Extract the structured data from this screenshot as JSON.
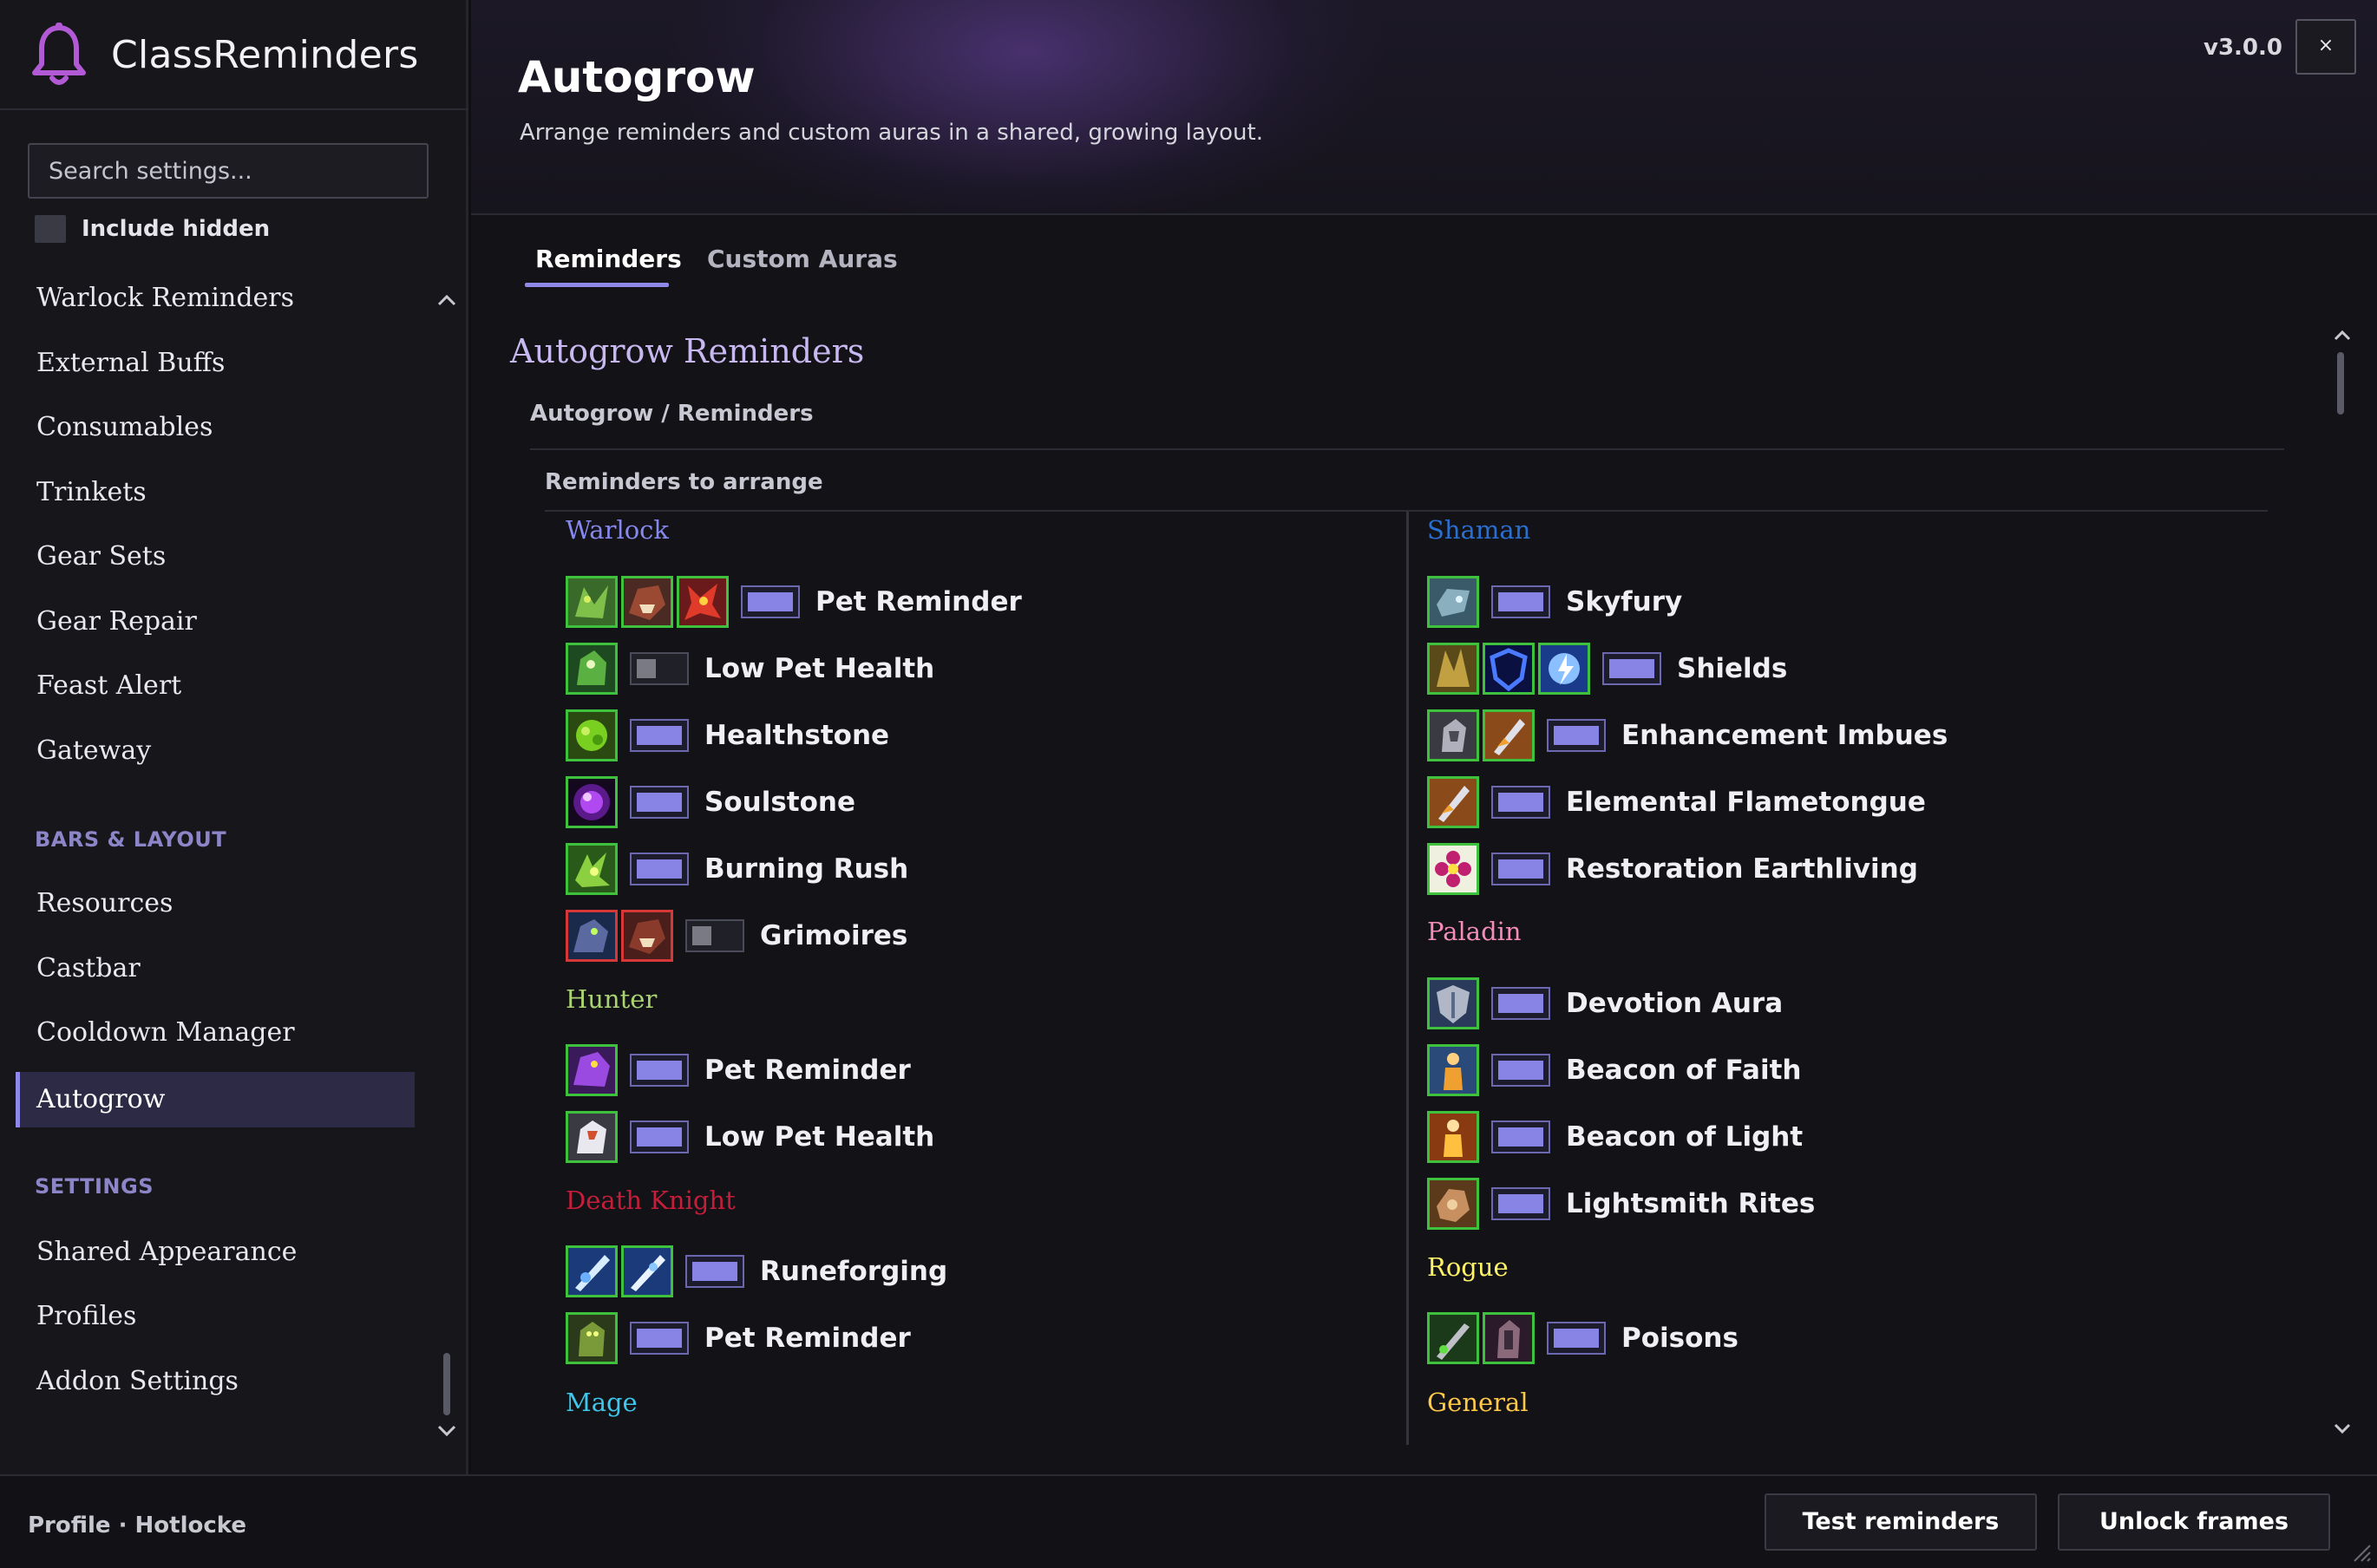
{
  "app": {
    "name": "ClassReminders",
    "version": "v3.0.0",
    "close_label": "×"
  },
  "sidebar": {
    "search_placeholder": "Search settings...",
    "include_hidden_label": "Include hidden",
    "items_top": [
      {
        "label": "Warlock Reminders"
      },
      {
        "label": "External Buffs"
      },
      {
        "label": "Consumables"
      },
      {
        "label": "Trinkets"
      },
      {
        "label": "Gear Sets"
      },
      {
        "label": "Gear Repair"
      },
      {
        "label": "Feast Alert"
      },
      {
        "label": "Gateway"
      }
    ],
    "section_bars": "BARS & LAYOUT",
    "items_bars": [
      {
        "label": "Resources"
      },
      {
        "label": "Castbar"
      },
      {
        "label": "Cooldown Manager"
      },
      {
        "label": "Autogrow"
      }
    ],
    "section_settings": "SETTINGS",
    "items_settings": [
      {
        "label": "Shared Appearance"
      },
      {
        "label": "Profiles"
      },
      {
        "label": "Addon Settings"
      }
    ],
    "active_item": "Autogrow"
  },
  "header": {
    "title": "Autogrow",
    "subtitle": "Arrange reminders and custom auras in a shared, growing layout."
  },
  "tabs": [
    {
      "label": "Reminders",
      "active": true
    },
    {
      "label": "Custom Auras",
      "active": false
    }
  ],
  "content": {
    "section_title": "Autogrow Reminders",
    "breadcrumb": "Autogrow / Reminders",
    "subheading": "Reminders to arrange",
    "left_groups": [
      {
        "label": "Warlock",
        "color": "#8788ee",
        "rows": [
          {
            "label": "Pet Reminder",
            "icons": [
              "felguard-icon",
              "felhunter-icon",
              "imp-icon"
            ],
            "enabled": true
          },
          {
            "label": "Low Pet Health",
            "icons": [
              "voidwalker-icon"
            ],
            "enabled": false
          },
          {
            "label": "Healthstone",
            "icons": [
              "healthstone-icon"
            ],
            "enabled": true
          },
          {
            "label": "Soulstone",
            "icons": [
              "soulstone-icon"
            ],
            "enabled": true
          },
          {
            "label": "Burning Rush",
            "icons": [
              "burning-rush-icon"
            ],
            "enabled": true
          },
          {
            "label": "Grimoires",
            "icons": [
              "grimoire-felguard-icon",
              "grimoire-felhunter-icon"
            ],
            "enabled": false
          }
        ]
      },
      {
        "label": "Hunter",
        "color": "#aad372",
        "rows": [
          {
            "label": "Pet Reminder",
            "icons": [
              "hunter-pet-icon"
            ],
            "enabled": true
          },
          {
            "label": "Low Pet Health",
            "icons": [
              "mend-pet-icon"
            ],
            "enabled": true
          }
        ]
      },
      {
        "label": "Death Knight",
        "color": "#c41e3a",
        "rows": [
          {
            "label": "Runeforging",
            "icons": [
              "rune-of-razorice-icon",
              "rune-of-fallen-crusader-icon"
            ],
            "enabled": true
          },
          {
            "label": "Pet Reminder",
            "icons": [
              "ghoul-icon"
            ],
            "enabled": true
          }
        ]
      },
      {
        "label": "Mage",
        "color": "#3fc7eb",
        "rows": []
      }
    ],
    "right_groups": [
      {
        "label": "Shaman",
        "color": "#2a6fd0",
        "rows": [
          {
            "label": "Skyfury",
            "icons": [
              "skyfury-icon"
            ],
            "enabled": true
          },
          {
            "label": "Shields",
            "icons": [
              "earth-shield-icon",
              "water-shield-icon",
              "lightning-shield-icon"
            ],
            "enabled": true
          },
          {
            "label": "Enhancement Imbues",
            "icons": [
              "windfury-weapon-icon",
              "flametongue-weapon-icon"
            ],
            "enabled": true
          },
          {
            "label": "Elemental Flametongue",
            "icons": [
              "flametongue-icon"
            ],
            "enabled": true
          },
          {
            "label": "Restoration Earthliving",
            "icons": [
              "earthliving-icon"
            ],
            "enabled": true
          }
        ]
      },
      {
        "label": "Paladin",
        "color": "#f48cba",
        "rows": [
          {
            "label": "Devotion Aura",
            "icons": [
              "devotion-aura-icon"
            ],
            "enabled": true
          },
          {
            "label": "Beacon of Faith",
            "icons": [
              "beacon-of-faith-icon"
            ],
            "enabled": true
          },
          {
            "label": "Beacon of Light",
            "icons": [
              "beacon-of-light-icon"
            ],
            "enabled": true
          },
          {
            "label": "Lightsmith Rites",
            "icons": [
              "lightsmith-rites-icon"
            ],
            "enabled": true
          }
        ]
      },
      {
        "label": "Rogue",
        "color": "#fff468",
        "rows": [
          {
            "label": "Poisons",
            "icons": [
              "deadly-poison-icon",
              "crippling-poison-icon"
            ],
            "enabled": true
          }
        ]
      },
      {
        "label": "General",
        "color": "#ffc94a",
        "rows": []
      }
    ]
  },
  "footer": {
    "profile_text": "Profile · Hotlocke",
    "test_button": "Test reminders",
    "unlock_button": "Unlock frames"
  },
  "colors": {
    "accent": "#8e88e8",
    "icon_border_active": "#3ec23e",
    "icon_border_missing": "#d63838",
    "bell": "#b25ad6"
  }
}
